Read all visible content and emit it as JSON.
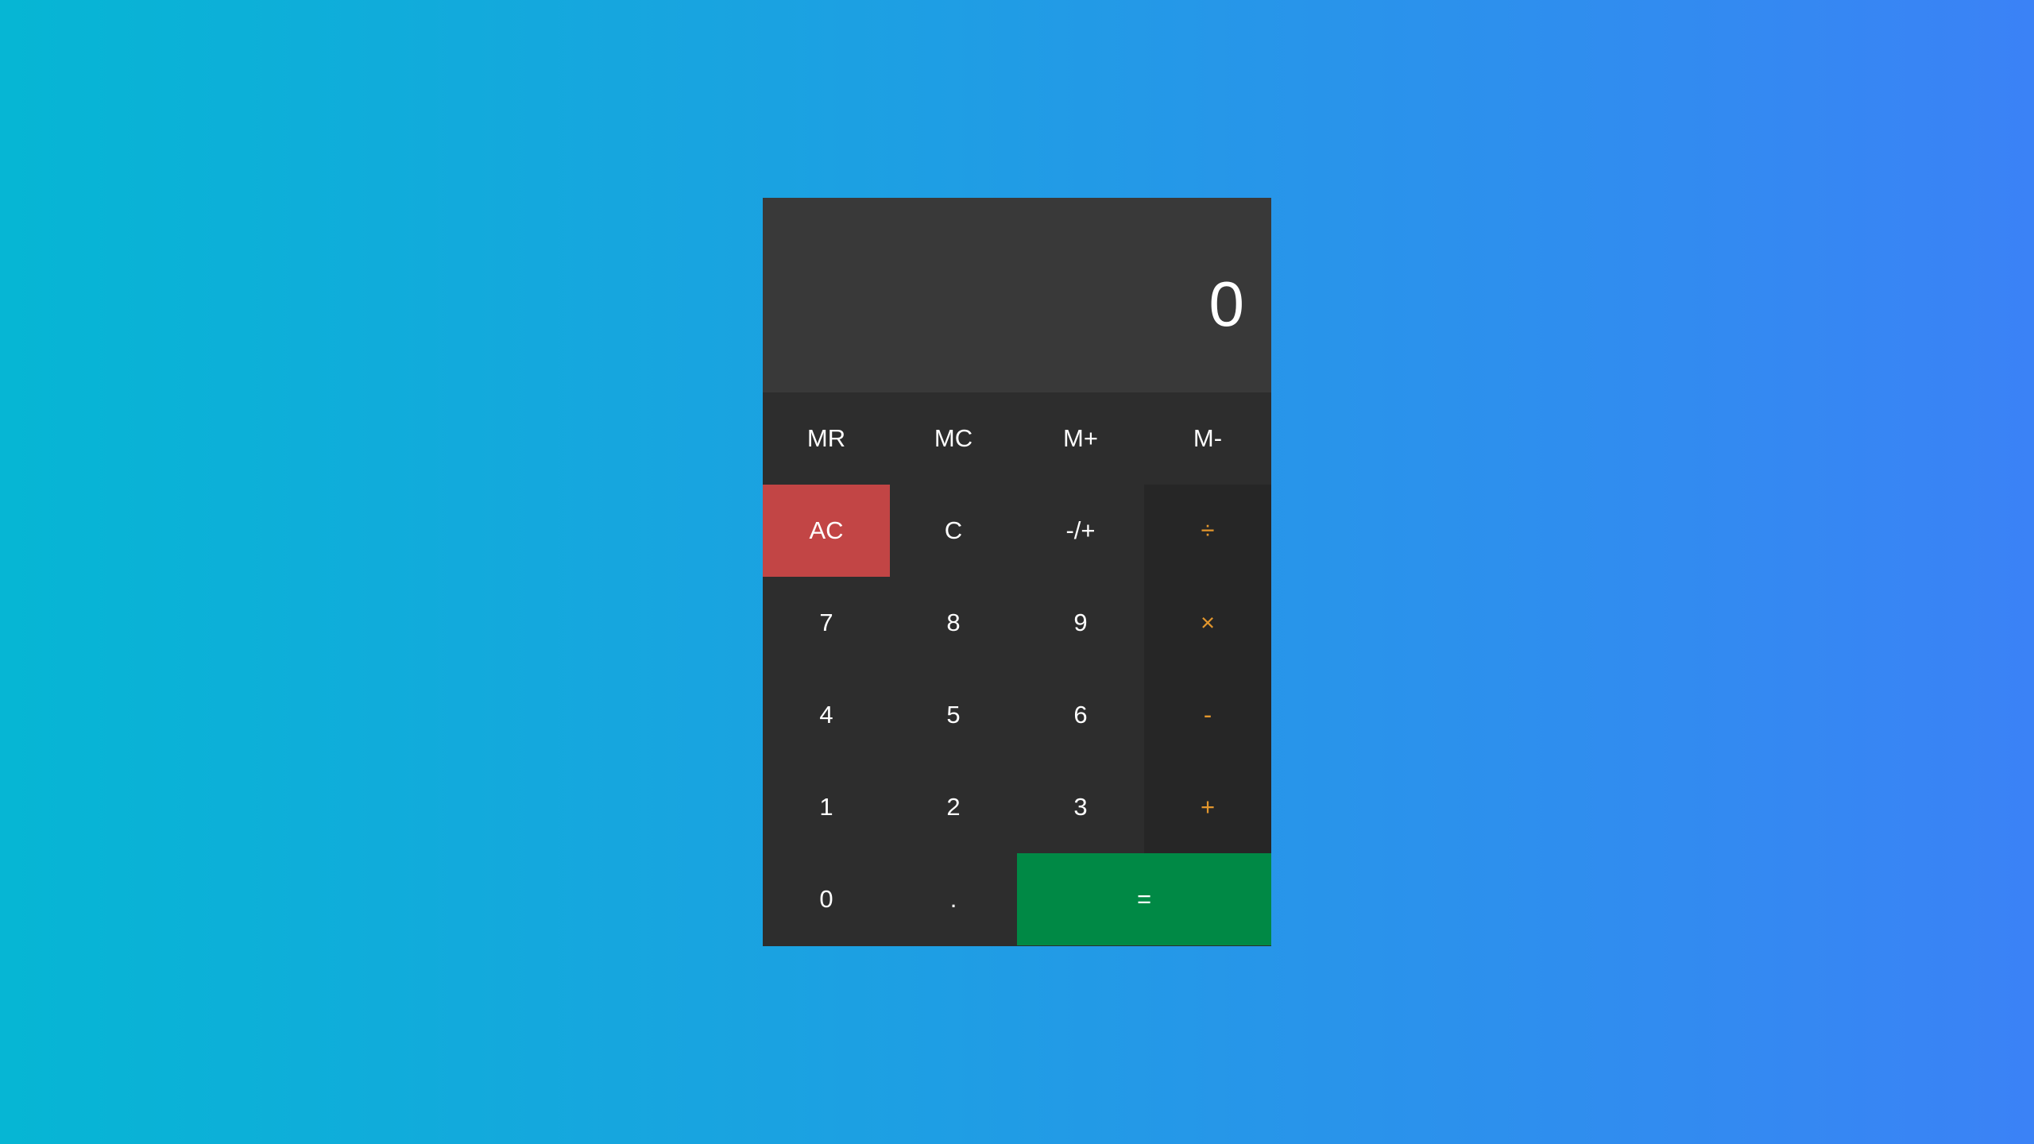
{
  "display": {
    "value": "0"
  },
  "memory_row": [
    "MR",
    "MC",
    "M+",
    "M-"
  ],
  "keys": {
    "ac": "AC",
    "c": "C",
    "negate": "-/+",
    "divide": "÷",
    "seven": "7",
    "eight": "8",
    "nine": "9",
    "multiply": "×",
    "four": "4",
    "five": "5",
    "six": "6",
    "subtract": "-",
    "one": "1",
    "two": "2",
    "three": "3",
    "add": "+",
    "zero": "0",
    "decimal": ".",
    "equals": "="
  },
  "colors": {
    "background_start": "#06b6d4",
    "background_end": "#3b82f6",
    "display_bg": "#393939",
    "key_bg": "#2d2d2d",
    "operator_bg": "#262626",
    "operator_text": "#e2962d",
    "ac_bg": "#c24545",
    "equals_bg": "#008945"
  }
}
